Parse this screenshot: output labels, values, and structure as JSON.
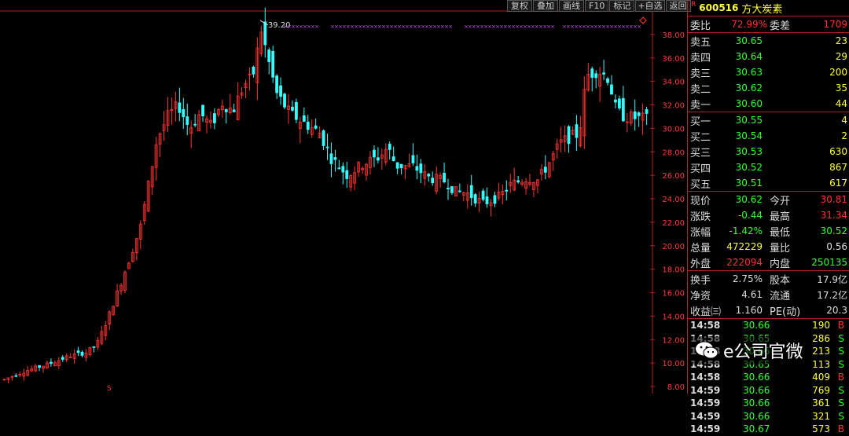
{
  "toolbar": {
    "restore": "复权",
    "overlay": "叠加",
    "draw": "画线",
    "f10": "F10",
    "mark": "标记",
    "add_fav": "+自选",
    "back": "返回"
  },
  "stock": {
    "flag": "R",
    "code": "600516",
    "name": "方大炭素"
  },
  "quote": {
    "weibi_label": "委比",
    "weibi_value": "72.99%",
    "weicha_label": "委差",
    "weicha_value": "1709",
    "asks": [
      {
        "label": "卖五",
        "price": "30.65",
        "vol": "23"
      },
      {
        "label": "卖四",
        "price": "30.64",
        "vol": "29"
      },
      {
        "label": "卖三",
        "price": "30.63",
        "vol": "200"
      },
      {
        "label": "卖二",
        "price": "30.62",
        "vol": "35"
      },
      {
        "label": "卖一",
        "price": "30.60",
        "vol": "44"
      }
    ],
    "bids": [
      {
        "label": "买一",
        "price": "30.55",
        "vol": "4"
      },
      {
        "label": "买二",
        "price": "30.54",
        "vol": "2"
      },
      {
        "label": "买三",
        "price": "30.53",
        "vol": "630"
      },
      {
        "label": "买四",
        "price": "30.52",
        "vol": "867"
      },
      {
        "label": "买五",
        "price": "30.51",
        "vol": "617"
      }
    ],
    "stats1": [
      {
        "l1": "现价",
        "v1": "30.62",
        "l2": "今开",
        "v2": "30.81"
      },
      {
        "l1": "涨跌",
        "v1": "-0.44",
        "l2": "最高",
        "v2": "31.34"
      },
      {
        "l1": "涨幅",
        "v1": "-1.42%",
        "l2": "最低",
        "v2": "30.52"
      },
      {
        "l1": "总量",
        "v1": "472229",
        "l2": "量比",
        "v2": "0.56"
      },
      {
        "l1": "外盘",
        "v1": "222094",
        "l2": "内盘",
        "v2": "250135"
      }
    ],
    "stats2": [
      {
        "l1": "换手",
        "v1": "2.75%",
        "l2": "股本",
        "v2": "17.9亿"
      },
      {
        "l1": "净资",
        "v1": "4.61",
        "l2": "流通",
        "v2": "17.2亿"
      },
      {
        "l1": "收益㈢",
        "v1": "1.160",
        "l2": "PE(动)",
        "v2": "20.3"
      }
    ],
    "ticks": [
      {
        "time": "14:58",
        "price": "30.66",
        "vol": "190",
        "side": "B"
      },
      {
        "time": "14:58",
        "price": "30.65",
        "vol": "286",
        "side": "S"
      },
      {
        "time": "14:58",
        "price": "30.66",
        "vol": "213",
        "side": "S"
      },
      {
        "time": "14:58",
        "price": "30.65",
        "vol": "113",
        "side": "S"
      },
      {
        "time": "14:58",
        "price": "30.66",
        "vol": "409",
        "side": "B"
      },
      {
        "time": "14:59",
        "price": "30.66",
        "vol": "769",
        "side": "S"
      },
      {
        "time": "14:59",
        "price": "30.66",
        "vol": "361",
        "side": "S"
      },
      {
        "time": "14:59",
        "price": "30.66",
        "vol": "321",
        "side": "S"
      },
      {
        "time": "14:59",
        "price": "30.67",
        "vol": "573",
        "side": "B"
      }
    ]
  },
  "watermark": {
    "text": "e公司官微"
  },
  "chart_data": {
    "type": "candlestick",
    "y_ticks": [
      "8.00",
      "10.00",
      "12.00",
      "14.00",
      "16.00",
      "18.00",
      "20.00",
      "22.00",
      "24.00",
      "26.00",
      "28.00",
      "30.00",
      "32.00",
      "34.00",
      "36.00",
      "38.00"
    ],
    "ylim": [
      7.4,
      40.0
    ],
    "max_label": "39.20",
    "x_count": 166,
    "up_color": "#ff3333",
    "down_color": "#33ffff",
    "marker_color": "#cc44ff",
    "key_closes": [
      [
        0,
        8.6
      ],
      [
        18,
        9.3
      ],
      [
        40,
        9.9
      ],
      [
        60,
        10.6
      ],
      [
        75,
        10.9
      ],
      [
        85,
        11.6
      ],
      [
        95,
        13.8
      ],
      [
        105,
        16.3
      ],
      [
        115,
        18.9
      ],
      [
        125,
        21.6
      ],
      [
        133,
        25.5
      ],
      [
        140,
        29.0
      ],
      [
        150,
        31.0
      ],
      [
        160,
        32.0
      ],
      [
        170,
        30.0
      ],
      [
        180,
        31.3
      ],
      [
        190,
        30.2
      ],
      [
        200,
        32.2
      ],
      [
        210,
        31.5
      ],
      [
        220,
        33.7
      ],
      [
        228,
        34.3
      ],
      [
        236,
        38.4
      ],
      [
        242,
        36.0
      ],
      [
        250,
        33.0
      ],
      [
        262,
        31.3
      ],
      [
        275,
        30.5
      ],
      [
        290,
        29.6
      ],
      [
        300,
        27.5
      ],
      [
        315,
        26.0
      ],
      [
        330,
        27.0
      ],
      [
        345,
        27.6
      ],
      [
        352,
        28.4
      ],
      [
        360,
        26.8
      ],
      [
        375,
        26.8
      ],
      [
        390,
        25.8
      ],
      [
        405,
        25.5
      ],
      [
        415,
        24.6
      ],
      [
        425,
        24.5
      ],
      [
        440,
        23.6
      ],
      [
        455,
        24.2
      ],
      [
        465,
        25.2
      ],
      [
        480,
        25.8
      ],
      [
        490,
        25.6
      ],
      [
        500,
        27.0
      ],
      [
        510,
        28.7
      ],
      [
        520,
        29.3
      ],
      [
        528,
        29.5
      ],
      [
        535,
        34.5
      ],
      [
        545,
        35.0
      ],
      [
        555,
        34.3
      ],
      [
        562,
        31.5
      ],
      [
        570,
        31.0
      ],
      [
        580,
        30.9
      ],
      [
        590,
        30.8
      ]
    ]
  }
}
